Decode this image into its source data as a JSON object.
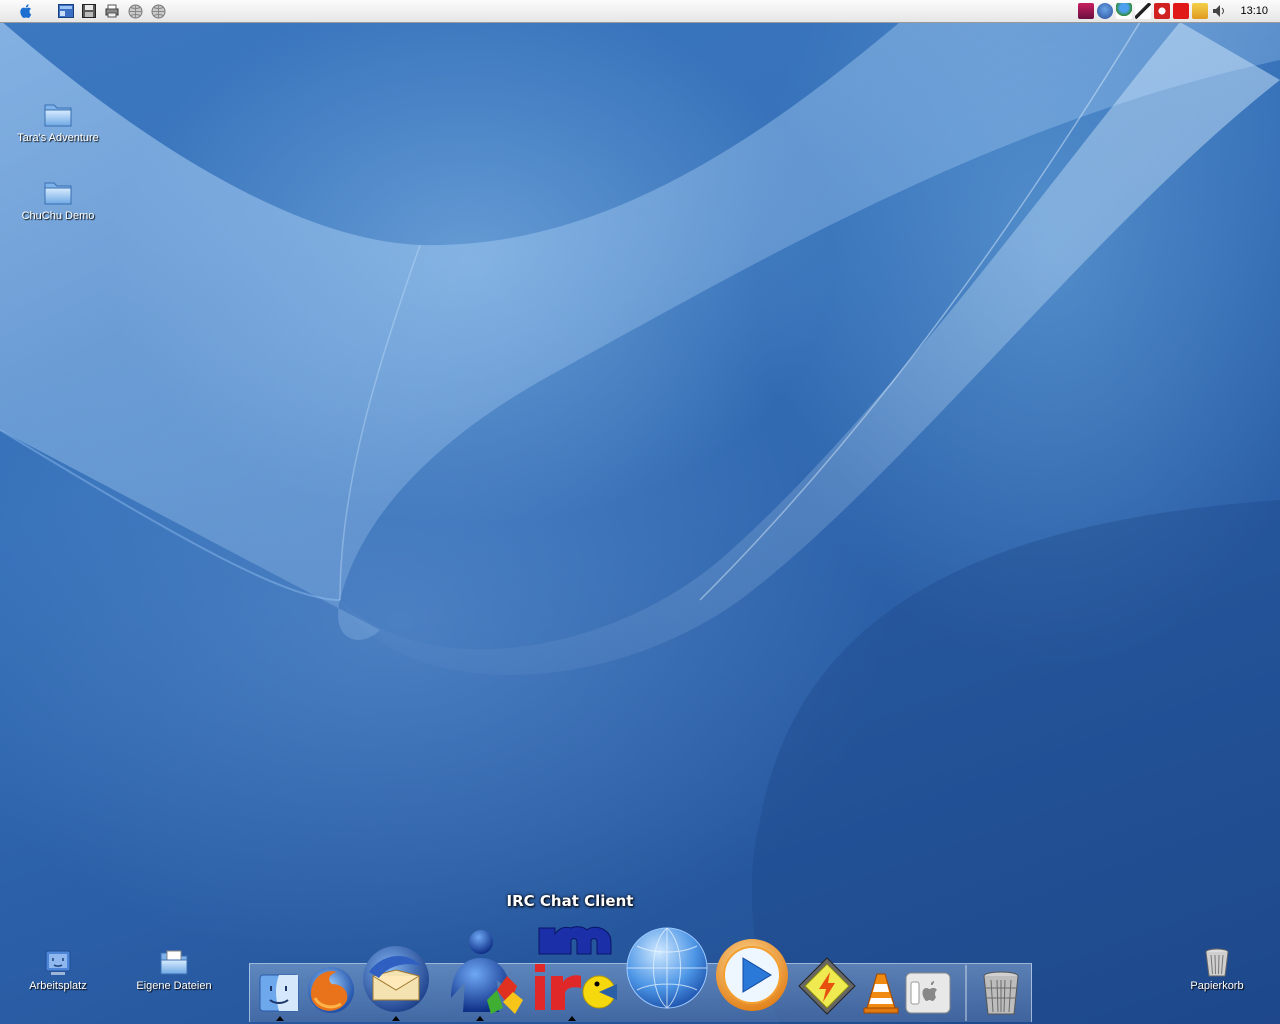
{
  "menubar": {
    "apple_icon": "apple-icon",
    "quicklaunch": [
      "show-desktop-icon",
      "save-disk-icon",
      "printer-icon",
      "gray-globe-icon",
      "gray-globe-2-icon"
    ],
    "tray_icons": [
      "antivirus-icon",
      "thunderbird-tray-icon",
      "messenger-tray-icon",
      "phone-tray-icon",
      "shield-tray-icon",
      "acrobat-tray-icon",
      "mail-tray-icon",
      "volume-icon"
    ],
    "clock": "13:10"
  },
  "desktop": {
    "icons": [
      {
        "label": "Tara's Adventure",
        "icon": "folder-icon"
      },
      {
        "label": "ChuChu Demo",
        "icon": "folder-icon"
      },
      {
        "label": "Arbeitsplatz",
        "icon": "computer-icon"
      },
      {
        "label": "Eigene Dateien",
        "icon": "documents-folder-icon"
      },
      {
        "label": "Papierkorb",
        "icon": "trash-icon"
      }
    ]
  },
  "dock": {
    "tooltip": "IRC Chat Client",
    "items": [
      {
        "icon": "finder-icon",
        "running": true
      },
      {
        "icon": "firefox-icon",
        "running": false
      },
      {
        "icon": "thunderbird-icon",
        "running": true
      },
      {
        "icon": "msn-messenger-icon",
        "running": true
      },
      {
        "icon": "mirc-icon",
        "running": true
      },
      {
        "icon": "network-globe-icon",
        "running": false
      },
      {
        "icon": "media-player-icon",
        "running": false
      },
      {
        "icon": "winamp-lightning-icon",
        "running": false
      },
      {
        "icon": "vlc-cone-icon",
        "running": false
      },
      {
        "icon": "apple-switch-icon",
        "running": false
      },
      {
        "icon": "trash-can-icon",
        "running": false
      }
    ]
  },
  "colors": {
    "wallpaper_top": "#3c78c0",
    "wallpaper_bottom": "#1f4a8e",
    "menubar": "#f2f2f2"
  }
}
